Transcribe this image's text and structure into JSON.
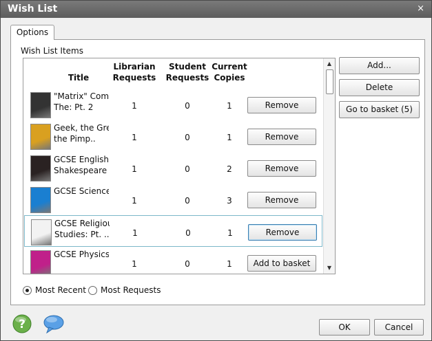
{
  "window": {
    "title": "Wish List",
    "close_glyph": "×"
  },
  "tabs": [
    {
      "label": "Options",
      "active": true
    }
  ],
  "group_label": "Wish List Items",
  "columns": {
    "title": "Title",
    "librarian_requests": "Librarian Requests",
    "student_requests": "Student Requests",
    "current_copies": "Current Copies"
  },
  "rows": [
    {
      "title_line1": "\"Matrix\" Comic",
      "title_line2": "The: Pt. 2",
      "librarian": "1",
      "student": "0",
      "copies": "1",
      "action": "Remove",
      "cover_color": "#333333"
    },
    {
      "title_line1": "Geek, the Gree",
      "title_line2": "the Pimp..",
      "librarian": "1",
      "student": "0",
      "copies": "1",
      "action": "Remove",
      "cover_color": "#d9a020"
    },
    {
      "title_line1": "GCSE English",
      "title_line2": "Shakespeare T",
      "librarian": "1",
      "student": "0",
      "copies": "2",
      "action": "Remove",
      "cover_color": "#2a2222"
    },
    {
      "title_line1": "GCSE Science",
      "title_line2": "",
      "librarian": "1",
      "student": "0",
      "copies": "3",
      "action": "Remove",
      "cover_color": "#1a7fd1"
    },
    {
      "title_line1": "GCSE Religious",
      "title_line2": "Studies: Pt. ..",
      "librarian": "1",
      "student": "0",
      "copies": "1",
      "action": "Remove",
      "cover_color": "#f2f2f2",
      "selected": true
    },
    {
      "title_line1": "GCSE Physics",
      "title_line2": "",
      "librarian": "1",
      "student": "0",
      "copies": "1",
      "action": "Add to basket",
      "cover_color": "#c0208a"
    }
  ],
  "side_buttons": {
    "add": "Add...",
    "delete": "Delete",
    "go_to_basket": "Go to basket (5)"
  },
  "sort": {
    "most_recent": "Most Recent",
    "most_requests": "Most Requests",
    "selected": "most_recent"
  },
  "footer": {
    "ok": "OK",
    "cancel": "Cancel"
  },
  "colors": {
    "titlebar": "#6b6b6b",
    "selection_border": "#7bb7c9",
    "help": "#5aa23a",
    "chat": "#4a90d9"
  }
}
